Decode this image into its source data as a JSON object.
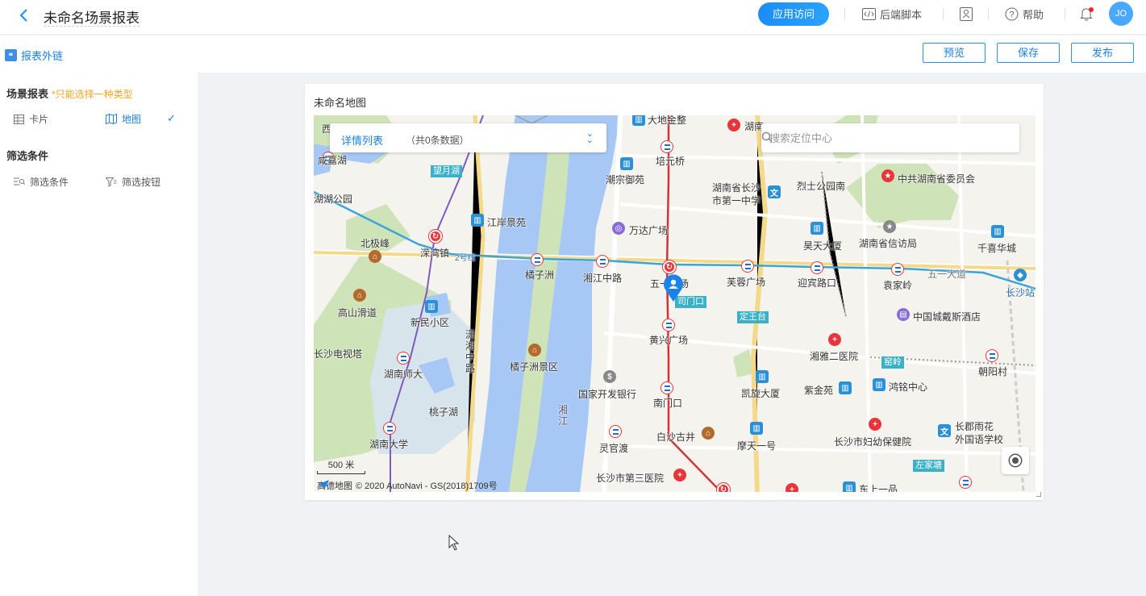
{
  "header": {
    "title": "未命名场景报表",
    "app_access": "应用访问",
    "backend_script": "后端脚本",
    "help": "帮助",
    "avatar": "JO"
  },
  "subbar": {
    "ext_link": "报表外链",
    "preview": "预览",
    "save": "保存",
    "publish": "发布"
  },
  "left": {
    "scene_title": "场景报表",
    "scene_hint": "*只能选择一种类型",
    "card": "卡片",
    "map": "地图",
    "filter_title": "筛选条件",
    "filter_condition": "筛选条件",
    "filter_button": "筛选按钮"
  },
  "card": {
    "title": "未命名地图"
  },
  "map": {
    "detail_title": "详情列表",
    "detail_count": "（共0条数据）",
    "search_placeholder": "搜索定位中心",
    "scale": "500 米",
    "provider": "高德地图",
    "copyright": "© 2020 AutoNavi - GS(2018)1709号",
    "labels": [
      "西",
      "大地金整",
      "湖南",
      "咸嘉湖",
      "望月湖",
      "培元桥",
      "湖湖公园",
      "湖南省长沙",
      "市第一中学",
      "潮宗御苑",
      "烈士公园南",
      "中共湖南省委员会",
      "江岸景苑",
      "万达广场",
      "北极峰",
      "昊天大厦",
      "湖南省信访局",
      "千喜华城",
      "溁湾镇",
      "2号线",
      "橘子洲",
      "湘江中路",
      "五一广场",
      "芙蓉广场",
      "迎宾路口",
      "袁家岭",
      "五一大道",
      "长沙站",
      "高山滑道",
      "新民小区",
      "司门口",
      "中国城戴斯酒店",
      "定王台",
      "潇湘中路",
      "黄兴广场",
      "长沙电视塔",
      "湖南师大",
      "橘子洲景区",
      "湘雅二医院",
      "窑岭",
      "朝阳村",
      "国家开发银行",
      "凯旋大厦",
      "紫金苑",
      "鸿铭中心",
      "桃子湖",
      "南门口",
      "湘江",
      "长郡雨花",
      "外国语学校",
      "湖南大学",
      "灵官渡",
      "白沙古井",
      "摩天一号",
      "长沙市妇幼保健院",
      "左家塘",
      "长沙市第三医院",
      "东上一品"
    ]
  },
  "colors": {
    "accent": "#1a82e8",
    "hint": "#f5a623",
    "water": "#a7c8f5",
    "metro_line_2": "#3aa5d8",
    "metro_line_1": "#d0343a"
  }
}
